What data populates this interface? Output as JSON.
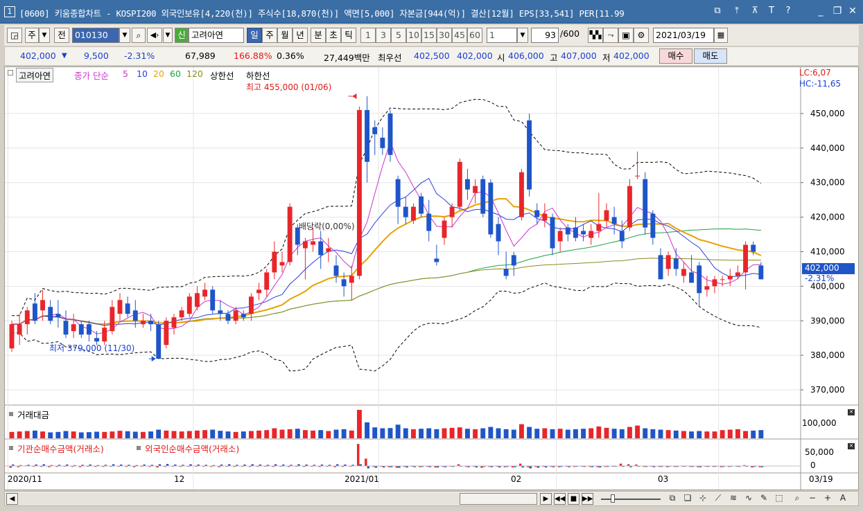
{
  "window": {
    "number": "1",
    "title": "[0600] 키움종합차트 - KOSPI200 외국인보유[4,220(천)] 주식수[18,870(천)] 액면[5,000] 자본금[944(억)] 결산[12월] EPS[33,541] PER[11.99",
    "title_icons": [
      "restore-icon",
      "pin-icon",
      "fix-icon",
      "text-icon",
      "help-icon"
    ],
    "title_glyphs": [
      "⧉",
      "⤒",
      "⊼",
      "T",
      "?"
    ],
    "minimize": "_",
    "restore": "❐",
    "close": "✕"
  },
  "toolbar": {
    "period_type": "주",
    "market_type": "전",
    "stock_code": "010130",
    "new_badge": "신",
    "stock_name": "고려아연",
    "periods": [
      "일",
      "주",
      "월",
      "년",
      "분",
      "초",
      "틱"
    ],
    "selected_period": "일",
    "intervals": [
      "1",
      "3",
      "5",
      "10",
      "15",
      "30",
      "45",
      "60"
    ],
    "multiplier": "1",
    "count": "93",
    "count_total": "/600",
    "date": "2021/03/19"
  },
  "quote": {
    "price": "402,000",
    "change": "9,500",
    "change_rate": "-2.31%",
    "volume": "67,989",
    "volume_ratio": "166.88%",
    "turnover": "0.36%",
    "amount": "27,449백만",
    "best_label": "최우선",
    "best_ask": "402,500",
    "best_bid": "402,000",
    "open_label": "시",
    "open": "406,000",
    "high_label": "고",
    "high": "407,000",
    "low_label": "저",
    "low": "402,000",
    "buy_label": "매수",
    "sell_label": "매도"
  },
  "colors": {
    "up": "#e8262a",
    "down": "#1f55c8",
    "ma5": "#cc33cc",
    "ma10": "#2a3fd8",
    "ma20": "#e8a100",
    "ma60": "#1aa340",
    "ma120": "#8a8a20",
    "band": "#000000"
  },
  "legend": {
    "name": "고려아연",
    "ma_label": "종가 단순",
    "ma_periods": [
      "5",
      "10",
      "20",
      "60",
      "120"
    ],
    "upper": "상한선",
    "lower": "하한선"
  },
  "corner": {
    "lc": "LC:6,07",
    "hc": "HC:-11,65"
  },
  "price_axis": {
    "ticks": [
      "450,000",
      "440,000",
      "430,000",
      "420,000",
      "410,000",
      "400,000",
      "390,000",
      "380,000",
      "370,000"
    ],
    "current": "402,000",
    "current_rate": "-2.31%"
  },
  "annotations": {
    "high": "최고 455,000 (01/06)",
    "low": "최저 379,000 (11/30)",
    "dividend": "배당락(0,00%)"
  },
  "panels": {
    "volume_title": "거래대금",
    "volume_tick": "100,000",
    "netbuy_title1": "기관순매수금액(거래소)",
    "netbuy_title2": "외국인순매수금액(거래소)",
    "netbuy_ticks": [
      "50,000",
      "0"
    ]
  },
  "x_axis": {
    "labels": [
      "2020/11",
      "12",
      "2021/01",
      "02",
      "03"
    ],
    "current": "03/19"
  },
  "chart_data": {
    "type": "candlestick",
    "y_unit": "KRW",
    "ylim": [
      366000,
      459000
    ],
    "candles": [
      {
        "o": 382000,
        "h": 390000,
        "l": 381000,
        "c": 389000
      },
      {
        "o": 386000,
        "h": 392000,
        "l": 383000,
        "c": 389000
      },
      {
        "o": 389000,
        "h": 394000,
        "l": 386000,
        "c": 393000
      },
      {
        "o": 395000,
        "h": 398000,
        "l": 389000,
        "c": 390000
      },
      {
        "o": 393000,
        "h": 399000,
        "l": 390000,
        "c": 396000
      },
      {
        "o": 394000,
        "h": 396000,
        "l": 389000,
        "c": 390000
      },
      {
        "o": 392000,
        "h": 396000,
        "l": 388000,
        "c": 391000
      },
      {
        "o": 390000,
        "h": 393000,
        "l": 385000,
        "c": 386000
      },
      {
        "o": 387000,
        "h": 392000,
        "l": 385000,
        "c": 389000
      },
      {
        "o": 389000,
        "h": 390000,
        "l": 385000,
        "c": 386000
      },
      {
        "o": 389000,
        "h": 390000,
        "l": 384000,
        "c": 386000
      },
      {
        "o": 385000,
        "h": 387000,
        "l": 383000,
        "c": 384000
      },
      {
        "o": 384000,
        "h": 390000,
        "l": 383000,
        "c": 388000
      },
      {
        "o": 387000,
        "h": 396000,
        "l": 386000,
        "c": 394000
      },
      {
        "o": 392000,
        "h": 398000,
        "l": 390000,
        "c": 396000
      },
      {
        "o": 395000,
        "h": 397000,
        "l": 391000,
        "c": 392000
      },
      {
        "o": 393000,
        "h": 396000,
        "l": 388000,
        "c": 390000
      },
      {
        "o": 389000,
        "h": 392000,
        "l": 388000,
        "c": 390000
      },
      {
        "o": 390000,
        "h": 392000,
        "l": 387000,
        "c": 389000
      },
      {
        "o": 389000,
        "h": 390000,
        "l": 379000,
        "c": 379000
      },
      {
        "o": 383000,
        "h": 391000,
        "l": 382000,
        "c": 390000
      },
      {
        "o": 388000,
        "h": 392000,
        "l": 386000,
        "c": 391000
      },
      {
        "o": 391000,
        "h": 394000,
        "l": 390000,
        "c": 393000
      },
      {
        "o": 392000,
        "h": 398000,
        "l": 391000,
        "c": 397000
      },
      {
        "o": 394000,
        "h": 400000,
        "l": 393000,
        "c": 398000
      },
      {
        "o": 397000,
        "h": 401000,
        "l": 396000,
        "c": 399000
      },
      {
        "o": 399000,
        "h": 400000,
        "l": 392000,
        "c": 393000
      },
      {
        "o": 393000,
        "h": 396000,
        "l": 390000,
        "c": 392000
      },
      {
        "o": 392000,
        "h": 393000,
        "l": 389000,
        "c": 390000
      },
      {
        "o": 390000,
        "h": 394000,
        "l": 389000,
        "c": 393000
      },
      {
        "o": 392000,
        "h": 393000,
        "l": 390000,
        "c": 391000
      },
      {
        "o": 392000,
        "h": 398000,
        "l": 390000,
        "c": 397000
      },
      {
        "o": 398000,
        "h": 401000,
        "l": 396000,
        "c": 399000
      },
      {
        "o": 399000,
        "h": 405000,
        "l": 397000,
        "c": 404000
      },
      {
        "o": 404000,
        "h": 413000,
        "l": 402000,
        "c": 410000
      },
      {
        "o": 406000,
        "h": 410000,
        "l": 404000,
        "c": 407000
      },
      {
        "o": 407000,
        "h": 424000,
        "l": 406000,
        "c": 423000
      },
      {
        "o": 417000,
        "h": 418000,
        "l": 409000,
        "c": 412000
      },
      {
        "o": 411000,
        "h": 414000,
        "l": 402000,
        "c": 413000
      },
      {
        "o": 412000,
        "h": 417000,
        "l": 410000,
        "c": 413000
      },
      {
        "o": 413000,
        "h": 416000,
        "l": 405000,
        "c": 409000
      },
      {
        "o": 410000,
        "h": 414000,
        "l": 407000,
        "c": 411000
      },
      {
        "o": 406000,
        "h": 409000,
        "l": 401000,
        "c": 403000
      },
      {
        "o": 402000,
        "h": 404000,
        "l": 397000,
        "c": 400000
      },
      {
        "o": 401000,
        "h": 406000,
        "l": 396000,
        "c": 403000
      },
      {
        "o": 403000,
        "h": 452000,
        "l": 402000,
        "c": 451000
      },
      {
        "o": 451000,
        "h": 455000,
        "l": 430000,
        "c": 436000
      },
      {
        "o": 446000,
        "h": 448000,
        "l": 438000,
        "c": 444000
      },
      {
        "o": 443000,
        "h": 446000,
        "l": 438000,
        "c": 440000
      },
      {
        "o": 450000,
        "h": 451000,
        "l": 436000,
        "c": 438000
      },
      {
        "o": 431000,
        "h": 432000,
        "l": 418000,
        "c": 423000
      },
      {
        "o": 423000,
        "h": 426000,
        "l": 418000,
        "c": 420000
      },
      {
        "o": 419000,
        "h": 424000,
        "l": 418000,
        "c": 423000
      },
      {
        "o": 426000,
        "h": 427000,
        "l": 420000,
        "c": 421000
      },
      {
        "o": 421000,
        "h": 425000,
        "l": 413000,
        "c": 416000
      },
      {
        "o": 408000,
        "h": 412000,
        "l": 406000,
        "c": 407000
      },
      {
        "o": 414000,
        "h": 420000,
        "l": 412000,
        "c": 419000
      },
      {
        "o": 420000,
        "h": 424000,
        "l": 417000,
        "c": 423000
      },
      {
        "o": 423000,
        "h": 437000,
        "l": 422000,
        "c": 436000
      },
      {
        "o": 431000,
        "h": 434000,
        "l": 425000,
        "c": 428000
      },
      {
        "o": 427000,
        "h": 431000,
        "l": 424000,
        "c": 429000
      },
      {
        "o": 431000,
        "h": 432000,
        "l": 420000,
        "c": 421000
      },
      {
        "o": 430000,
        "h": 431000,
        "l": 414000,
        "c": 415000
      },
      {
        "o": 418000,
        "h": 420000,
        "l": 409000,
        "c": 413000
      },
      {
        "o": 405000,
        "h": 410000,
        "l": 402000,
        "c": 403000
      },
      {
        "o": 409000,
        "h": 410000,
        "l": 403000,
        "c": 406000
      },
      {
        "o": 420000,
        "h": 434000,
        "l": 419000,
        "c": 433000
      },
      {
        "o": 448000,
        "h": 450000,
        "l": 426000,
        "c": 428000
      },
      {
        "o": 422000,
        "h": 424000,
        "l": 418000,
        "c": 420000
      },
      {
        "o": 419000,
        "h": 424000,
        "l": 417000,
        "c": 421000
      },
      {
        "o": 420000,
        "h": 421000,
        "l": 409000,
        "c": 411000
      },
      {
        "o": 413000,
        "h": 417000,
        "l": 410000,
        "c": 416000
      },
      {
        "o": 417000,
        "h": 418000,
        "l": 413000,
        "c": 415000
      },
      {
        "o": 417000,
        "h": 420000,
        "l": 413000,
        "c": 414000
      },
      {
        "o": 416000,
        "h": 418000,
        "l": 413000,
        "c": 415000
      },
      {
        "o": 414000,
        "h": 418000,
        "l": 412000,
        "c": 416000
      },
      {
        "o": 416000,
        "h": 427000,
        "l": 414000,
        "c": 418000
      },
      {
        "o": 419000,
        "h": 424000,
        "l": 417000,
        "c": 422000
      },
      {
        "o": 420000,
        "h": 423000,
        "l": 415000,
        "c": 418000
      },
      {
        "o": 416000,
        "h": 419000,
        "l": 411000,
        "c": 413000
      },
      {
        "o": 417000,
        "h": 431000,
        "l": 416000,
        "c": 429000
      },
      {
        "o": 432000,
        "h": 439000,
        "l": 431000,
        "c": 432000
      },
      {
        "o": 431000,
        "h": 433000,
        "l": 415000,
        "c": 417000
      },
      {
        "o": 421000,
        "h": 422000,
        "l": 412000,
        "c": 414000
      },
      {
        "o": 409000,
        "h": 411000,
        "l": 402000,
        "c": 402000
      },
      {
        "o": 405000,
        "h": 410000,
        "l": 403000,
        "c": 409000
      },
      {
        "o": 408000,
        "h": 411000,
        "l": 403000,
        "c": 405000
      },
      {
        "o": 403000,
        "h": 407000,
        "l": 401000,
        "c": 405000
      },
      {
        "o": 404000,
        "h": 409000,
        "l": 401000,
        "c": 401000
      },
      {
        "o": 406000,
        "h": 407000,
        "l": 394000,
        "c": 398000
      },
      {
        "o": 399000,
        "h": 403000,
        "l": 397000,
        "c": 400000
      },
      {
        "o": 400000,
        "h": 403000,
        "l": 398000,
        "c": 402000
      },
      {
        "o": 402000,
        "h": 403000,
        "l": 400000,
        "c": 402000
      },
      {
        "o": 402000,
        "h": 405000,
        "l": 400000,
        "c": 403000
      },
      {
        "o": 403000,
        "h": 406000,
        "l": 402000,
        "c": 404000
      },
      {
        "o": 404000,
        "h": 413000,
        "l": 399000,
        "c": 412000
      },
      {
        "o": 412000,
        "h": 413000,
        "l": 409000,
        "c": 410000
      },
      {
        "o": 406000,
        "h": 407000,
        "l": 402000,
        "c": 402000
      }
    ],
    "volume_amount": [
      28,
      30,
      32,
      34,
      30,
      26,
      28,
      32,
      30,
      26,
      27,
      29,
      28,
      30,
      33,
      31,
      29,
      28,
      30,
      38,
      34,
      32,
      30,
      32,
      34,
      36,
      38,
      33,
      30,
      28,
      30,
      32,
      34,
      36,
      44,
      38,
      40,
      42,
      36,
      34,
      36,
      32,
      38,
      40,
      34,
      125,
      70,
      48,
      44,
      45,
      60,
      44,
      40,
      42,
      44,
      40,
      44,
      46,
      48,
      42,
      40,
      44,
      50,
      44,
      40,
      38,
      62,
      50,
      42,
      44,
      40,
      42,
      38,
      40,
      42,
      44,
      52,
      46,
      42,
      40,
      50,
      56,
      44,
      40,
      38,
      36,
      34,
      32,
      30,
      32,
      30,
      30,
      36,
      38,
      40,
      32,
      34,
      36
    ],
    "net_buy": [
      [
        -6,
        -4,
        2,
        -2,
        -3,
        -4,
        -3,
        -2,
        -3,
        -4,
        -2,
        -3,
        -3,
        -2,
        -1,
        -3,
        -4,
        -2,
        -3,
        -5,
        -3,
        -2,
        -3,
        -2,
        -1,
        -2,
        -3,
        -4,
        -2,
        -3,
        -2,
        -3,
        -2,
        -1,
        -3,
        -2,
        -3,
        -2,
        -3,
        -2,
        -3,
        -2,
        -4,
        -3,
        -2,
        75,
        25,
        -3,
        -2,
        -4,
        -6,
        -3,
        -2,
        -4,
        -3,
        -5,
        -3,
        -2,
        6,
        -3,
        -2,
        -6,
        -3,
        -2,
        -4,
        -5,
        8,
        -4,
        -3,
        -2,
        -3,
        -4,
        -2,
        -3,
        -2,
        -3,
        -4,
        -3,
        -2,
        8,
        6,
        5,
        -3,
        -2,
        -3,
        -4,
        -3,
        -2,
        -3,
        -4,
        -2,
        -3,
        -4,
        -3,
        -2,
        3,
        -5,
        -4
      ],
      [
        5,
        3,
        4,
        5,
        6,
        3,
        4,
        5,
        3,
        4,
        5,
        3,
        4,
        6,
        5,
        4,
        3,
        5,
        4,
        6,
        7,
        5,
        4,
        6,
        5,
        4,
        3,
        5,
        6,
        4,
        5,
        6,
        5,
        4,
        6,
        5,
        4,
        6,
        5,
        4,
        5,
        4,
        6,
        5,
        4,
        6,
        -8,
        -6,
        -5,
        -4,
        -6,
        -5,
        -4,
        -3,
        -4,
        -5,
        -4,
        -3,
        -2,
        -4,
        -5,
        -3,
        -4,
        -5,
        -3,
        -4,
        -5,
        -8,
        -6,
        -5,
        -4,
        -3,
        -4,
        -2,
        -3,
        -4,
        -5,
        -3,
        -2,
        -3,
        -4,
        -2,
        -3,
        -4,
        -3,
        -2,
        -3,
        -2,
        -3,
        -4,
        -3,
        -2,
        -3,
        -2,
        -3,
        -2,
        -3,
        -4
      ]
    ]
  }
}
